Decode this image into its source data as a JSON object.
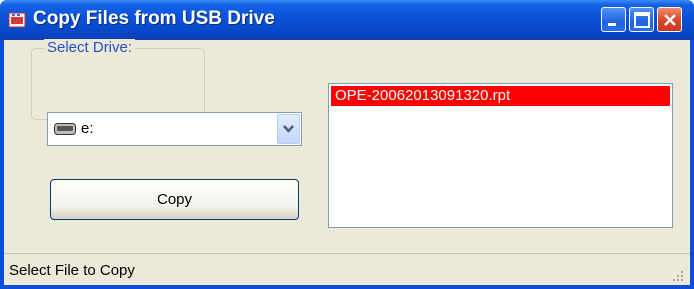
{
  "window": {
    "title": "Copy Files from USB Drive",
    "icon": "usb-app-icon"
  },
  "title_buttons": {
    "minimize_icon": "minimize-icon",
    "maximize_icon": "maximize-icon",
    "close_icon": "close-icon"
  },
  "drive_group": {
    "legend": "Select Drive:",
    "selected_drive": "e:",
    "drive_icon": "drive-icon",
    "dropdown_icon": "chevron-down-icon"
  },
  "actions": {
    "copy_label": "Copy"
  },
  "file_list": {
    "items": [
      {
        "name": "OPE-20062013091320.rpt",
        "selected": true
      }
    ],
    "selected_color": "#ff0000"
  },
  "status": {
    "text": "Select File to Copy"
  },
  "colors": {
    "titlebar": "#0a52d8",
    "client_bg": "#ece9d8",
    "legend_text": "#2450c6"
  }
}
